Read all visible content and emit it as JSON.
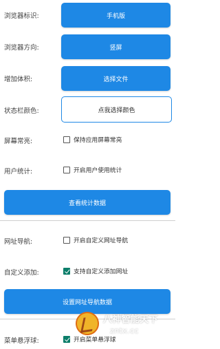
{
  "settings": {
    "browser_id": {
      "label": "浏览器标识:",
      "value": "手机版"
    },
    "browser_orientation": {
      "label": "浏览器方向:",
      "value": "竖屏"
    },
    "add_size": {
      "label": "增加体积:",
      "value": "选择文件"
    },
    "statusbar_color": {
      "label": "状态栏颜色:",
      "value": "点我选择颜色"
    },
    "screen_keep_on": {
      "label": "屏幕常亮:",
      "checkbox_label": "保持应用屏幕常亮",
      "checked": false
    },
    "user_stats": {
      "label": "用户统计:",
      "checkbox_label": "开启用户使用统计",
      "checked": false
    },
    "view_stats_button": "查看统计数据",
    "url_nav": {
      "label": "网址导航:",
      "checkbox_label": "开启自定义网址导航",
      "checked": false
    },
    "custom_add": {
      "label": "自定义添加:",
      "checkbox_label": "支持自定义添加网址",
      "checked": true
    },
    "set_nav_button": "设置网址导航数据",
    "menu_float": {
      "label": "菜单悬浮球:",
      "checkbox_label": "开启菜单悬浮球",
      "checked": true
    }
  },
  "watermark": {
    "title": "八神智能天下",
    "url": "zntx.cc"
  },
  "colors": {
    "primary": "#1e88e5",
    "checked": "#0b7e6a",
    "divider": "#cfcfcf"
  }
}
